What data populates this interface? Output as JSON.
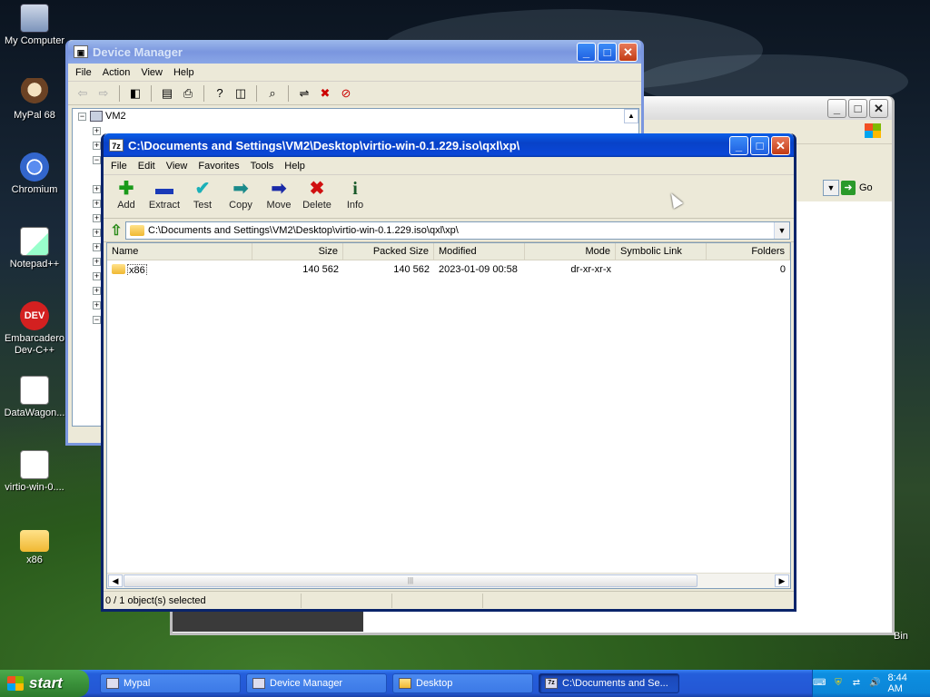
{
  "desktop": {
    "icons": [
      {
        "label": "My Computer",
        "icon": "computer-icon"
      },
      {
        "label": "MyPal 68",
        "icon": "mypal-icon"
      },
      {
        "label": "Chromium",
        "icon": "chromium-icon"
      },
      {
        "label": "Notepad++",
        "icon": "notepad-plus-plus-icon"
      },
      {
        "label": "Embarcadero Dev-C++",
        "icon": "devcpp-icon",
        "glyph": "DEV"
      },
      {
        "label": "DataWagon...",
        "icon": "shortcut-file-icon"
      },
      {
        "label": "virtio-win-0....",
        "icon": "iso-file-icon"
      },
      {
        "label": "x86",
        "icon": "folder-icon"
      }
    ],
    "recycle_bin_partial": "Bin"
  },
  "device_manager": {
    "title": "Device Manager",
    "menu": [
      "File",
      "Action",
      "View",
      "Help"
    ],
    "root_node": "VM2"
  },
  "background_window": {
    "go_label": "Go"
  },
  "sevenzip": {
    "title": "C:\\Documents and Settings\\VM2\\Desktop\\virtio-win-0.1.229.iso\\qxl\\xp\\",
    "title_icon": "7z",
    "menu": [
      "File",
      "Edit",
      "View",
      "Favorites",
      "Tools",
      "Help"
    ],
    "toolbar": [
      {
        "label": "Add",
        "icon": "add-icon",
        "glyph": "✚",
        "color": "#1a9a1a"
      },
      {
        "label": "Extract",
        "icon": "extract-icon",
        "glyph": "▬",
        "color": "#1a3ab8"
      },
      {
        "label": "Test",
        "icon": "test-icon",
        "glyph": "✔",
        "color": "#1ab0b8"
      },
      {
        "label": "Copy",
        "icon": "copy-icon",
        "glyph": "➡",
        "color": "#1a8a8a"
      },
      {
        "label": "Move",
        "icon": "move-icon",
        "glyph": "➡",
        "color": "#1a2aa8"
      },
      {
        "label": "Delete",
        "icon": "delete-icon",
        "glyph": "✖",
        "color": "#d01010"
      },
      {
        "label": "Info",
        "icon": "info-icon",
        "glyph": "i",
        "color": "#1a5a2a"
      }
    ],
    "path": "C:\\Documents and Settings\\VM2\\Desktop\\virtio-win-0.1.229.iso\\qxl\\xp\\",
    "columns": [
      "Name",
      "Size",
      "Packed Size",
      "Modified",
      "Mode",
      "Symbolic Link",
      "Folders"
    ],
    "rows": [
      {
        "name": "x86",
        "size": "140 562",
        "packed": "140 562",
        "modified": "2023-01-09 00:58",
        "mode": "dr-xr-xr-x",
        "symlink": "",
        "folders": "0"
      }
    ],
    "status": "0 / 1 object(s) selected"
  },
  "taskbar": {
    "start_label": "start",
    "tasks": [
      {
        "label": "Mypal",
        "icon": "mypal-icon"
      },
      {
        "label": "Device Manager",
        "icon": "device-manager-icon"
      },
      {
        "label": "Desktop",
        "icon": "folder-icon"
      },
      {
        "label": "C:\\Documents and Se...",
        "icon": "sevenzip-icon",
        "active": true
      }
    ],
    "clock": "8:44 AM"
  }
}
